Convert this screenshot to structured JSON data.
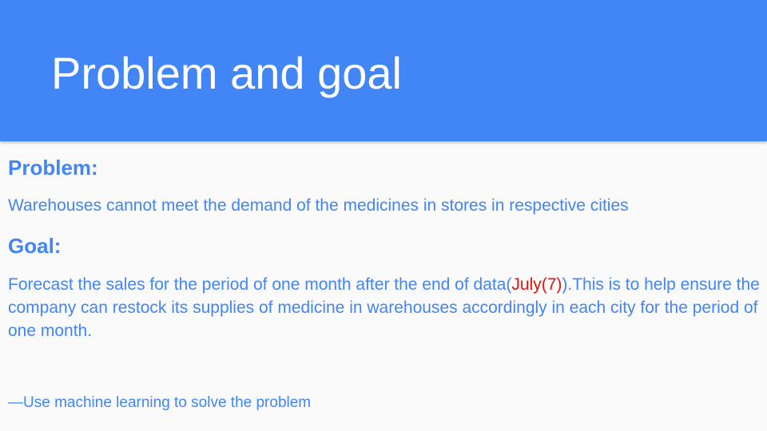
{
  "slide": {
    "title": "Problem and goal",
    "problem": {
      "heading": "Problem:",
      "text": "Warehouses cannot meet the demand of the medicines in stores in respective cities"
    },
    "goal": {
      "heading": "Goal:",
      "text_before": "Forecast the sales for the period of one month after the end of data(",
      "highlight": "July(7)",
      "text_after": ").This is to help ensure the company can restock its supplies of medicine in warehouses accordingly in each city for the period of one month."
    },
    "footnote": "—Use machine learning to solve the problem"
  },
  "colors": {
    "header_background": "#4285f4",
    "body_text": "#4285f4",
    "highlight": "#e3120b",
    "page_background": "#fafafa"
  }
}
